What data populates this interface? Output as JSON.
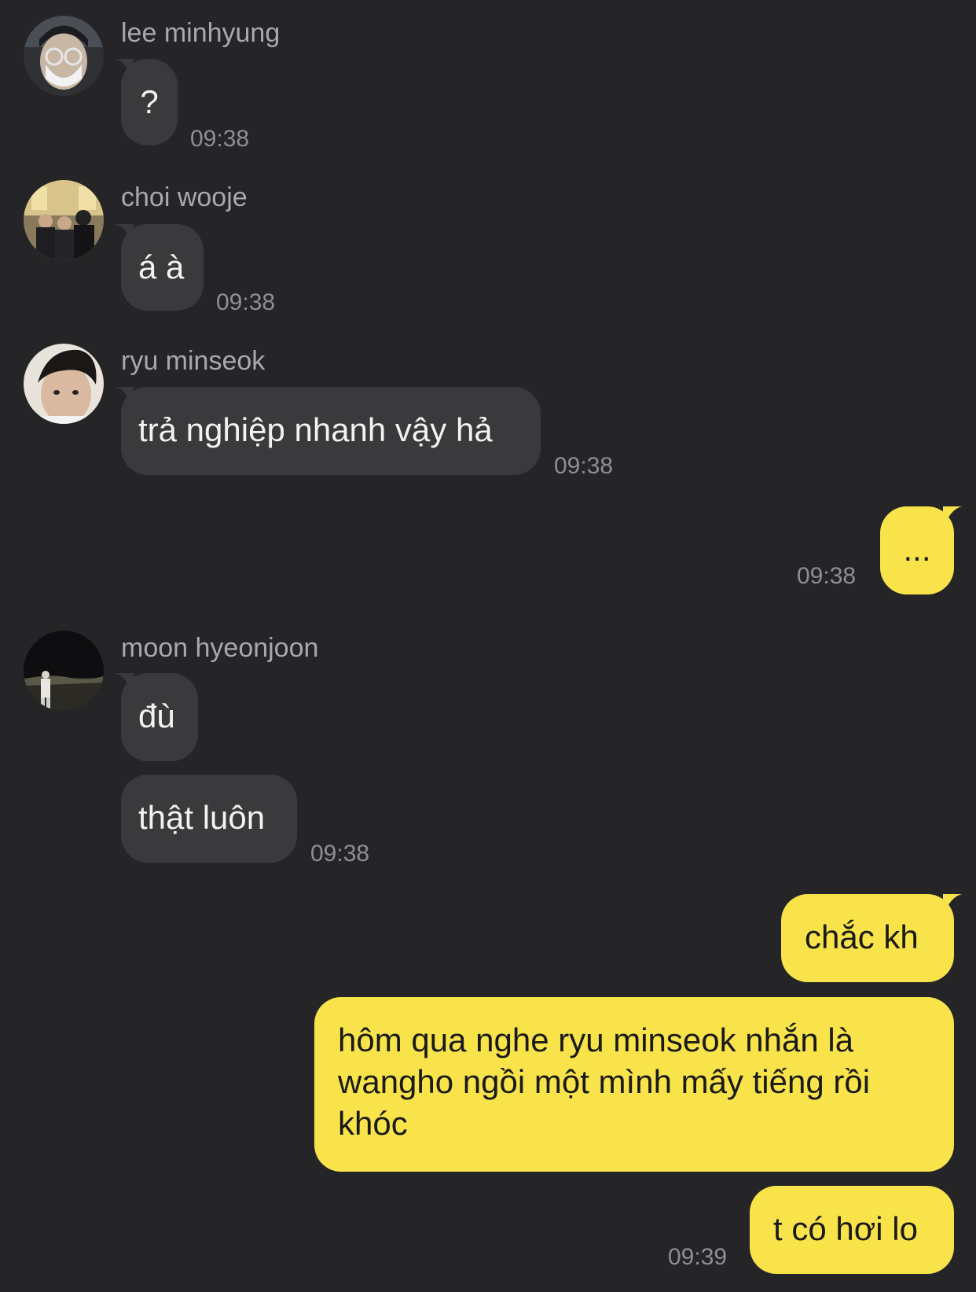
{
  "messages": [
    {
      "sender": "lee minhyung",
      "text": "?",
      "time": "09:38"
    },
    {
      "sender": "choi wooje",
      "text": "á à",
      "time": "09:38"
    },
    {
      "sender": "ryu minseok",
      "text": "trả nghiệp nhanh vậy hả",
      "time": "09:38"
    },
    {
      "text": "...",
      "time": "09:38"
    },
    {
      "sender": "moon hyeonjoon",
      "text": "đù"
    },
    {
      "text": "thật luôn",
      "time": "09:38"
    },
    {
      "text": "chắc kh"
    },
    {
      "text": "hôm qua nghe ryu minseok nhắn là wangho ngồi một mình mấy tiếng rồi khóc"
    },
    {
      "text": "t có hơi lo",
      "time": "09:39"
    }
  ],
  "colors": {
    "background": "#252527",
    "incoming_bubble": "#3a3a3d",
    "outgoing_bubble": "#f8e34b",
    "sender_name": "#a9a9ad",
    "timestamp": "#8e8e93"
  }
}
